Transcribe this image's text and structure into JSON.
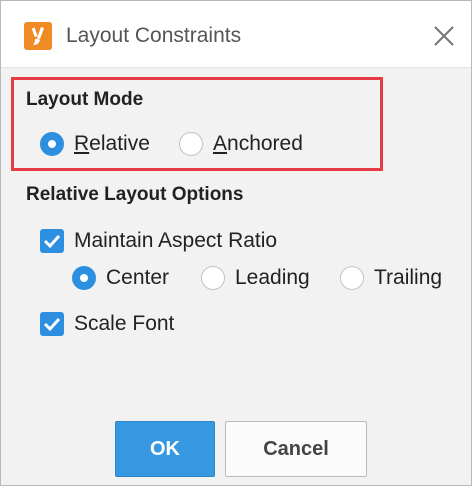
{
  "window": {
    "title": "Layout Constraints",
    "app_icon": "brush-icon",
    "close_icon": "close-icon"
  },
  "layout_mode": {
    "title": "Layout Mode",
    "selected": "Relative",
    "options": [
      {
        "label_first": "R",
        "label_rest": "elative",
        "selected": true
      },
      {
        "label_first": "A",
        "label_rest": "nchored",
        "selected": false
      }
    ]
  },
  "relative_options": {
    "title": "Relative Layout Options",
    "maintain_aspect_ratio": {
      "label": "Maintain Aspect Ratio",
      "checked": true
    },
    "alignment": [
      {
        "label": "Center",
        "selected": true
      },
      {
        "label": "Leading",
        "selected": false
      },
      {
        "label": "Trailing",
        "selected": false
      }
    ],
    "scale_font": {
      "label": "Scale Font",
      "checked": true
    }
  },
  "buttons": {
    "ok": "OK",
    "cancel": "Cancel"
  },
  "colors": {
    "accent": "#2d8fe0",
    "highlight_border": "#e53b44",
    "app_icon_bg": "#f08a24"
  }
}
